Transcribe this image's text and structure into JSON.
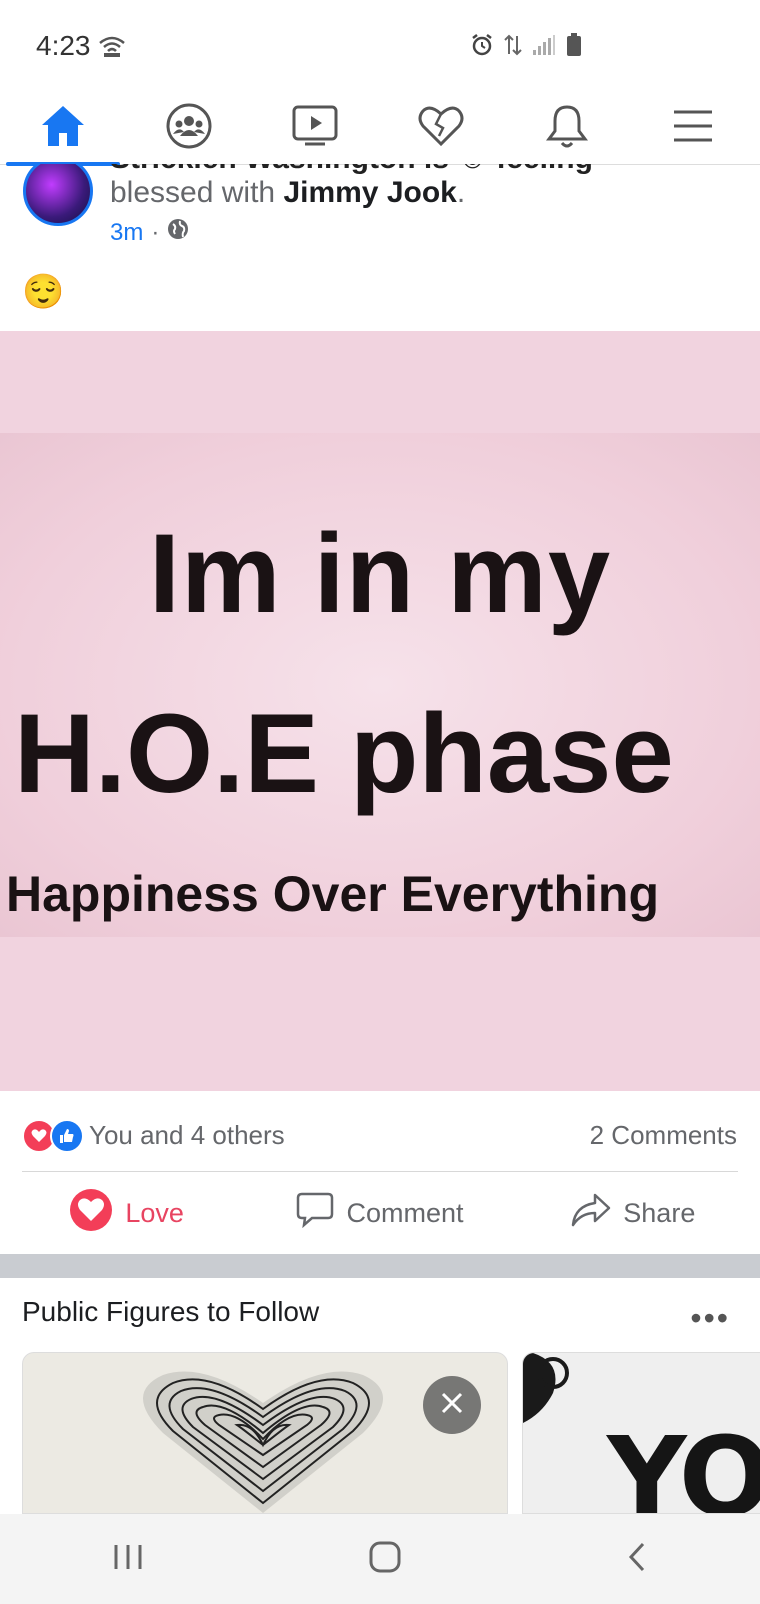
{
  "status_bar": {
    "time": "4:23"
  },
  "nav": {
    "items": [
      {
        "name": "home",
        "active": true
      },
      {
        "name": "groups",
        "active": false
      },
      {
        "name": "watch",
        "active": false
      },
      {
        "name": "dating",
        "active": false
      },
      {
        "name": "notifications",
        "active": false
      },
      {
        "name": "menu",
        "active": false
      }
    ],
    "accent_color": "#1877f2"
  },
  "post": {
    "author_partial": "Stricklen Washington is ☺ feeling",
    "feeling_prefix": "blessed with ",
    "tagged_friend": "Jimmy Jook",
    "feeling_suffix": ".",
    "time": "3m",
    "body_emoji": "😌",
    "image_text": {
      "line1": "Im in my",
      "line2": "H.O.E phase",
      "line3": "Happiness Over Everything"
    },
    "reactions_text": "You and 4 others",
    "comments_count": "2 Comments",
    "actions": {
      "love": "Love",
      "comment": "Comment",
      "share": "Share"
    }
  },
  "suggestions": {
    "title": "Public Figures to Follow",
    "card2_text": "YOU"
  }
}
